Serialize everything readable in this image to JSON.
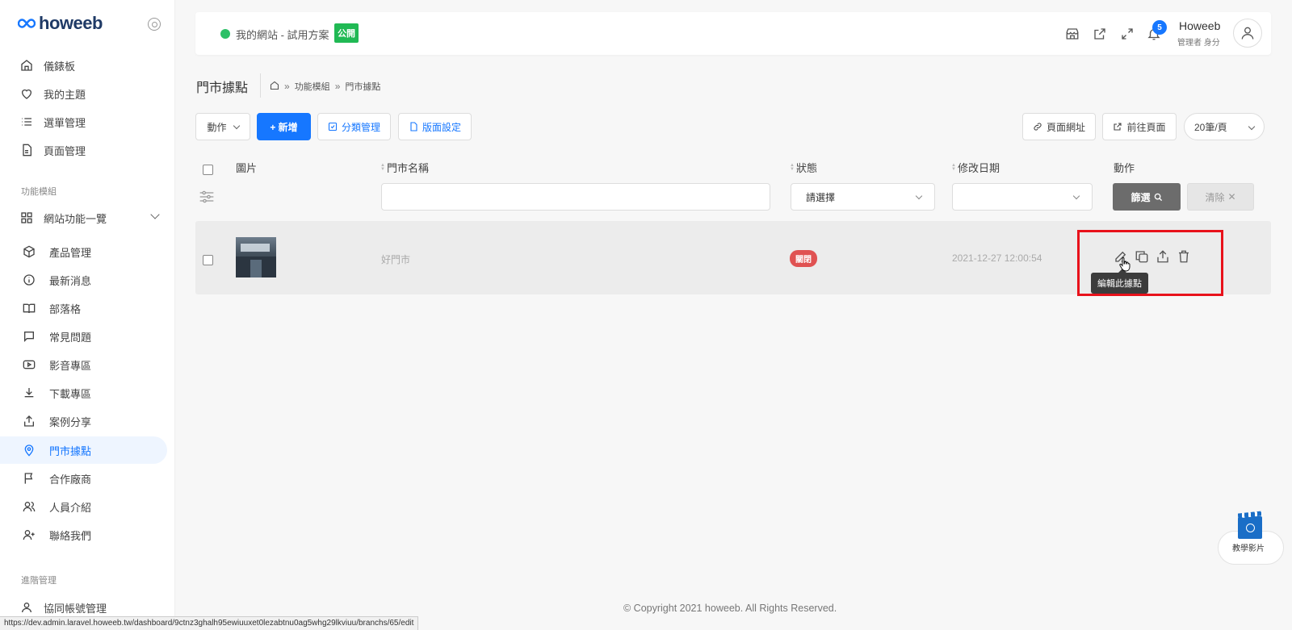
{
  "brand": {
    "name": "howeeb"
  },
  "sidebar": {
    "items": [
      {
        "label": "儀錶板",
        "icon": "home-icon"
      },
      {
        "label": "我的主題",
        "icon": "heart-icon"
      },
      {
        "label": "選單管理",
        "icon": "list-icon"
      },
      {
        "label": "頁面管理",
        "icon": "file-icon"
      }
    ],
    "section_modules": "功能模組",
    "modules_group": {
      "label": "網站功能一覽",
      "icon": "grid-icon"
    },
    "modules": [
      {
        "label": "產品管理",
        "icon": "box-icon"
      },
      {
        "label": "最新消息",
        "icon": "info-icon"
      },
      {
        "label": "部落格",
        "icon": "book-icon"
      },
      {
        "label": "常見問題",
        "icon": "message-icon"
      },
      {
        "label": "影音專區",
        "icon": "video-icon"
      },
      {
        "label": "下載專區",
        "icon": "download-icon"
      },
      {
        "label": "案例分享",
        "icon": "share-icon"
      },
      {
        "label": "門市據點",
        "icon": "map-pin-icon",
        "active": true
      },
      {
        "label": "合作廠商",
        "icon": "flag-icon"
      },
      {
        "label": "人員介紹",
        "icon": "users-icon"
      },
      {
        "label": "聯絡我們",
        "icon": "user-plus-icon"
      }
    ],
    "section_advanced": "進階管理",
    "advanced": [
      {
        "label": "協同帳號管理",
        "icon": "user-icon"
      }
    ]
  },
  "header": {
    "site_name": "我的網站 - 試用方案",
    "public_badge": "公開",
    "notification_count": "5",
    "user_name": "Howeeb",
    "user_role": "管理者 身分"
  },
  "page": {
    "title": "門市據點",
    "breadcrumb": [
      "功能模組",
      "門市據點"
    ],
    "breadcrumb_sep": "»"
  },
  "toolbar": {
    "action_label": "動作",
    "add_label": "+ 新增",
    "category_label": "分類管理",
    "layout_label": "版面設定",
    "page_url_label": "頁面網址",
    "goto_page_label": "前往頁面",
    "per_page": "20筆/頁"
  },
  "table": {
    "columns": {
      "image": "圖片",
      "name": "門市名稱",
      "status": "狀態",
      "modified": "修改日期",
      "action": "動作"
    },
    "filter": {
      "status_placeholder": "請選擇",
      "filter_btn": "篩選",
      "clear_btn": "清除"
    },
    "rows": [
      {
        "name": "好門市",
        "status": "關閉",
        "modified": "2021-12-27 12:00:54"
      }
    ],
    "tooltip": "編輯此據點"
  },
  "footer": {
    "copyright": "© Copyright 2021 howeeb. All Rights Reserved."
  },
  "status_url": "https://dev.admin.laravel.howeeb.tw/dashboard/9ctnz3ghalh95ewiuuxet0lezabtnu0ag5whg29lkviuu/branchs/65/edit",
  "tutorial": {
    "label": "教學影片"
  },
  "colors": {
    "primary": "#1677ff",
    "success": "#20b954",
    "danger": "#e05252",
    "highlight": "#e8121b"
  }
}
